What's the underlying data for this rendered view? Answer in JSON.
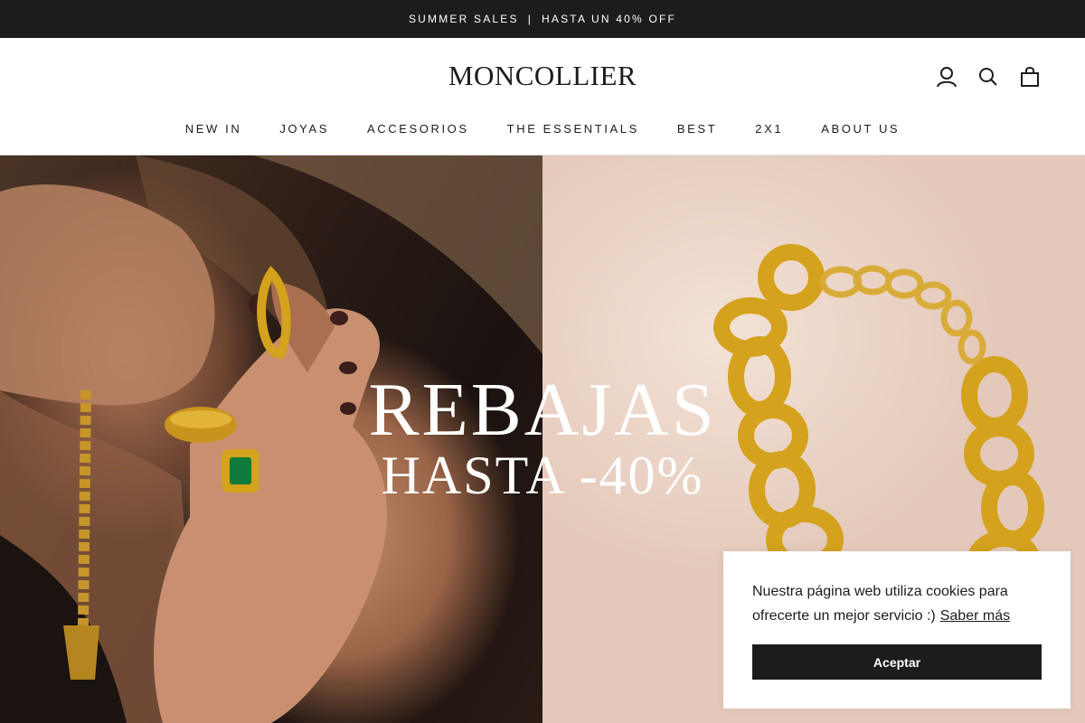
{
  "announcement": {
    "left": "SUMMER SALES",
    "separator": "|",
    "right": "HASTA UN 40% OFF"
  },
  "header": {
    "logo": "MONCOLLIER",
    "icons": [
      "account-icon",
      "search-icon",
      "cart-icon"
    ]
  },
  "nav": {
    "items": [
      "NEW IN",
      "JOYAS",
      "ACCESORIOS",
      "THE ESSENTIALS",
      "BEST",
      "2X1",
      "ABOUT US"
    ]
  },
  "hero": {
    "line1": "REBAJAS",
    "line2": "HASTA -40%"
  },
  "cookie": {
    "message": "Nuestra página web utiliza cookies para ofrecerte un mejor servicio :)",
    "link": "Saber más",
    "accept": "Aceptar"
  },
  "colors": {
    "dark": "#1c1c1c",
    "gold": "#d4a21c",
    "blush": "#ecd6c8"
  }
}
